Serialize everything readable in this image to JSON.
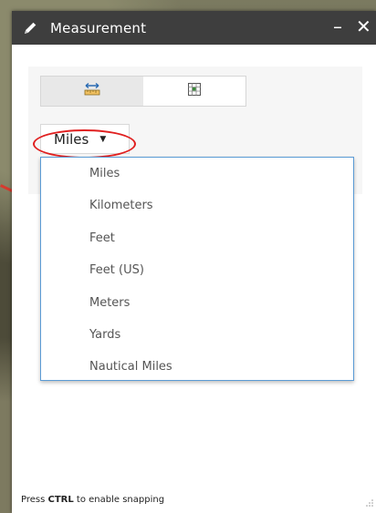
{
  "window": {
    "title": "Measurement",
    "minimize_label": "–",
    "close_label": "✕"
  },
  "tools": [
    {
      "icon": "distance-ruler-icon",
      "active": true
    },
    {
      "icon": "location-coordinates-icon",
      "active": false
    }
  ],
  "unit_select": {
    "selected": "Miles",
    "options": [
      "Miles",
      "Kilometers",
      "Feet",
      "Feet (US)",
      "Meters",
      "Yards",
      "Nautical Miles"
    ]
  },
  "footer": {
    "prefix": "Press ",
    "key": "CTRL",
    "suffix": " to enable snapping"
  },
  "colors": {
    "titlebar": "#3e3e3e",
    "annotation": "#e02020",
    "dropdown_border": "#5b9bd5"
  }
}
